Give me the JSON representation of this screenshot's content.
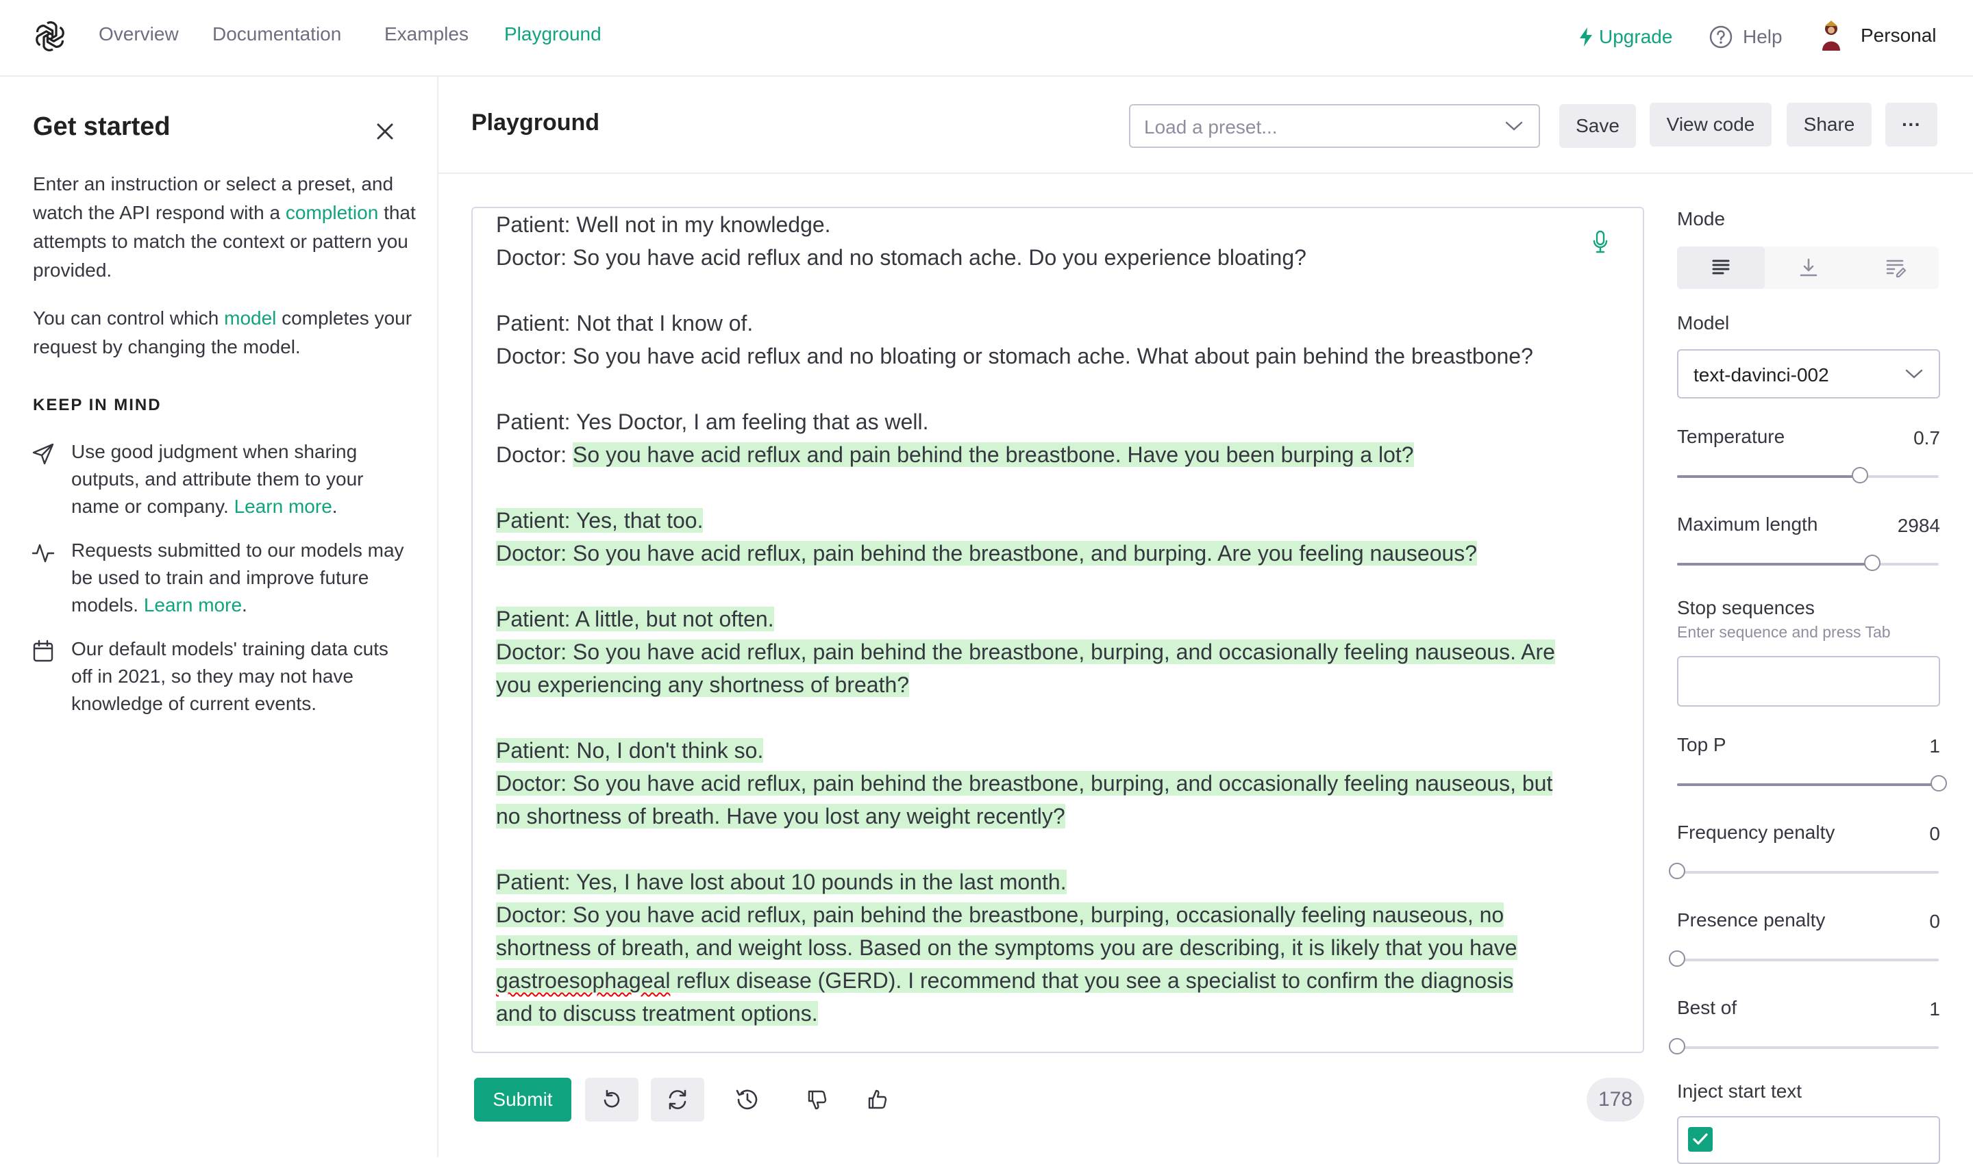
{
  "nav": {
    "links": [
      "Overview",
      "Documentation",
      "Examples",
      "Playground"
    ],
    "upgrade": "Upgrade",
    "help": "Help",
    "account": "Personal"
  },
  "sidebar": {
    "title": "Get started",
    "intro": {
      "p1_pre": "Enter an instruction or select a preset, and watch the API respond with a ",
      "p1_link": "completion",
      "p1_post": " that attempts to match the context or pattern you provided.",
      "p2_pre": "You can control which ",
      "p2_link": "model",
      "p2_post": " completes your request by changing the model."
    },
    "keep_in_mind": "KEEP IN MIND",
    "tips": [
      {
        "icon": "send-icon",
        "text": "Use good judgment when sharing outputs, and attribute them to your name or company. ",
        "link": "Learn more",
        "end": "."
      },
      {
        "icon": "activity-icon",
        "text": "Requests submitted to our models may be used to train and improve future models. ",
        "link": "Learn more",
        "end": "."
      },
      {
        "icon": "calendar-icon",
        "text": "Our default models' training data cuts off in 2021, so they may not have knowledge of current events.",
        "link": "",
        "end": ""
      }
    ]
  },
  "header": {
    "title": "Playground",
    "preset_placeholder": "Load a preset...",
    "save": "Save",
    "view_code": "View code",
    "share": "Share",
    "more": "···"
  },
  "editor": {
    "l1": "Patient: Well not in my knowledge.",
    "l2": "Doctor: So you have acid reflux and no stomach ache. Do you experience bloating?",
    "l3": "Patient: Not that I know of.",
    "l4": "Doctor: So you have acid reflux and no bloating or stomach ache. What about pain behind the breastbone?",
    "l5": "Patient: Yes Doctor, I am feeling that as well.",
    "l6a": "Doctor: ",
    "l6b": "So you have acid reflux and pain behind the breastbone. Have you been burping a lot?",
    "l7": "Patient: Yes, that too.",
    "l8": "Doctor: So you have acid reflux, pain behind the breastbone, and burping. Are you feeling nauseous?",
    "l9": "Patient: A little, but not often.",
    "l10": "Doctor: So you have acid reflux, pain behind the breastbone, burping, and occasionally feeling nauseous. Are",
    "l11": "you experiencing any shortness of breath?",
    "l12": "Patient: No, I don't think so.",
    "l13": "Doctor: So you have acid reflux, pain behind the breastbone, burping, and occasionally feeling nauseous, but",
    "l14": "no shortness of breath. Have you lost any weight recently?",
    "l15": "Patient: Yes, I have lost about 10 pounds in the last month.",
    "l16": "Doctor: So you have acid reflux, pain behind the breastbone, burping, occasionally feeling nauseous, no",
    "l17": "shortness of breath, and weight loss. Based on the symptoms you are describing, it is likely that you have",
    "l18a": "gastroesophageal",
    "l18b": " reflux disease (GERD). I recommend that you see a specialist to confirm the diagnosis",
    "l19": "and to discuss treatment options."
  },
  "toolbar": {
    "submit": "Submit",
    "token_count": "178"
  },
  "settings": {
    "mode_label": "Mode",
    "model_label": "Model",
    "model_value": "text-davinci-002",
    "temperature": {
      "label": "Temperature",
      "value": "0.7",
      "fraction": 0.7
    },
    "max_length": {
      "label": "Maximum length",
      "value": "2984",
      "fraction": 0.746
    },
    "stop_sequences": {
      "label": "Stop sequences",
      "hint": "Enter sequence and press Tab"
    },
    "top_p": {
      "label": "Top P",
      "value": "1",
      "fraction": 1.0
    },
    "frequency_penalty": {
      "label": "Frequency penalty",
      "value": "0",
      "fraction": 0.0
    },
    "presence_penalty": {
      "label": "Presence penalty",
      "value": "0",
      "fraction": 0.0
    },
    "best_of": {
      "label": "Best of",
      "value": "1",
      "fraction": 0.0
    },
    "inject_start_label": "Inject start text",
    "inject_checked": true
  },
  "colors": {
    "accent": "#10a37f",
    "highlight": "#d2f4d3"
  }
}
